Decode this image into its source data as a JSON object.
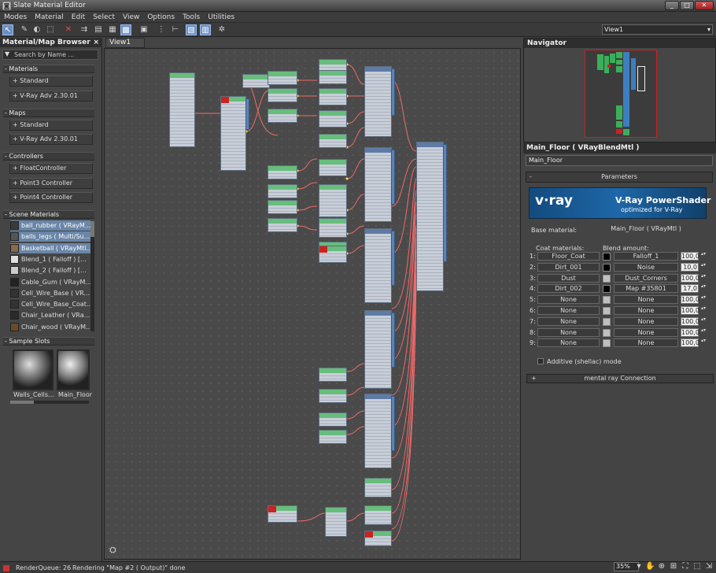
{
  "window": {
    "title": "Slate Material Editor",
    "app_icon": "slate-app-icon"
  },
  "menu": [
    "Modes",
    "Material",
    "Edit",
    "Select",
    "View",
    "Options",
    "Tools",
    "Utilities"
  ],
  "toolbar": {
    "view_dropdown": "View1"
  },
  "browser": {
    "title": "Material/Map Browser",
    "search_placeholder": "Search by Name ...",
    "sections": [
      {
        "label": "- Materials",
        "items": [
          "+ Standard",
          "+ V-Ray Adv 2.30.01"
        ]
      },
      {
        "label": "- Maps",
        "items": [
          "+ Standard",
          "+ V-Ray Adv 2.30.01"
        ]
      },
      {
        "label": "- Controllers",
        "items": [
          "+ FloatController",
          "+ Point3 Controller",
          "+ Point4 Controller"
        ]
      }
    ],
    "scene_materials_label": "- Scene Materials",
    "scene_materials": [
      {
        "name": "ball_rubber ( VRayM...",
        "color": "#3a3a3a"
      },
      {
        "name": "balls_legs ( Multi/Su...",
        "color": "#555555"
      },
      {
        "name": "Basketball ( VRayMtl...",
        "color": "#8a6a4a"
      },
      {
        "name": "Blend_1 ( Falloff ) [...",
        "color": "#e0e0e0"
      },
      {
        "name": "Blend_2 ( Falloff ) [...",
        "color": "#cccccc"
      },
      {
        "name": "Cable_Gum ( VRayM...",
        "color": "#222222"
      },
      {
        "name": "Cell_Wire_Base ( VR...",
        "color": "#333333"
      },
      {
        "name": "Cell_Wire_Base_Coat...",
        "color": "#333333"
      },
      {
        "name": "Chair_Leather ( VRa...",
        "color": "#2a2a2a"
      },
      {
        "name": "Chair_wood ( VRayM...",
        "color": "#6a4a2a"
      }
    ],
    "sample_slots_label": "- Sample Slots",
    "sample_slots": [
      "Walls_Cells...",
      "Main_Floor"
    ]
  },
  "view": {
    "tab": "View1"
  },
  "navigator": {
    "title": "Navigator"
  },
  "properties": {
    "header": "Main_Floor ( VRayBlendMtl )",
    "name_field": "Main_Floor",
    "params_rollout": "Parameters",
    "banner": {
      "logo": "v·ray",
      "title": "V-Ray PowerShader",
      "subtitle": "optimized for V-Ray"
    },
    "base_material_label": "Base material:",
    "base_material": "Main_Floor ( VRayMtl )",
    "coat_header": "Coat materials:",
    "blend_header": "Blend amount:",
    "rows": [
      {
        "idx": "1:",
        "coat": "Floor_Coat",
        "swatch": "#000000",
        "blend": "Falloff_1",
        "amount": "100,0"
      },
      {
        "idx": "2:",
        "coat": "Dirt_001",
        "swatch": "#000000",
        "blend": "Noise",
        "amount": "10,0"
      },
      {
        "idx": "3:",
        "coat": "Dust",
        "swatch": "#c0c0c0",
        "blend": "Dust_Corners",
        "amount": "100,0"
      },
      {
        "idx": "4:",
        "coat": "Dirt_002",
        "swatch": "#000000",
        "blend": "Map #35801",
        "amount": "17,0"
      },
      {
        "idx": "5:",
        "coat": "None",
        "swatch": "#c0c0c0",
        "blend": "None",
        "amount": "100,0"
      },
      {
        "idx": "6:",
        "coat": "None",
        "swatch": "#c0c0c0",
        "blend": "None",
        "amount": "100,0"
      },
      {
        "idx": "7:",
        "coat": "None",
        "swatch": "#c0c0c0",
        "blend": "None",
        "amount": "100,0"
      },
      {
        "idx": "8:",
        "coat": "None",
        "swatch": "#c0c0c0",
        "blend": "None",
        "amount": "100,0"
      },
      {
        "idx": "9:",
        "coat": "None",
        "swatch": "#c0c0c0",
        "blend": "None",
        "amount": "100,0"
      }
    ],
    "additive_label": "Additive (shellac) mode",
    "mental_ray": "mental ray Connection"
  },
  "status": {
    "render_queue": "RenderQueue: 26",
    "message": "Rendering \"Map #2 ( Output)\" done",
    "zoom": "35%"
  }
}
